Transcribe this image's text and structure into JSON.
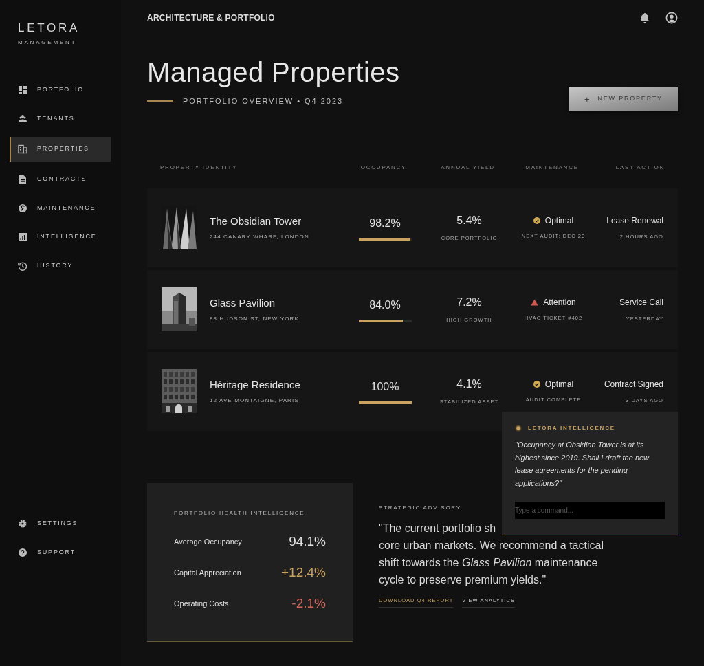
{
  "brand": {
    "name": "LETORA",
    "subtitle": "MANAGEMENT"
  },
  "nav": [
    {
      "label": "PORTFOLIO",
      "selected": false
    },
    {
      "label": "TENANTS",
      "selected": false
    },
    {
      "label": "PROPERTIES",
      "selected": true
    },
    {
      "label": "CONTRACTS",
      "selected": false
    },
    {
      "label": "MAINTENANCE",
      "selected": false
    },
    {
      "label": "INTELLIGENCE",
      "selected": false
    },
    {
      "label": "HISTORY",
      "selected": false
    }
  ],
  "footer_nav": [
    {
      "label": "SETTINGS"
    },
    {
      "label": "SUPPORT"
    }
  ],
  "header": {
    "breadcrumb": "ARCHITECTURE & PORTFOLIO"
  },
  "page": {
    "title": "Managed Properties",
    "subtitle": "PORTFOLIO OVERVIEW • Q4 2023"
  },
  "new_property_button": {
    "icon_text": "+",
    "label": "NEW PROPERTY"
  },
  "table": {
    "columns": [
      "PROPERTY IDENTITY",
      "OCCUPANCY",
      "ANNUAL YIELD",
      "MAINTENANCE",
      "LAST ACTION"
    ],
    "rows": [
      {
        "name": "The Obsidian Tower",
        "address": "244 CANARY WHARF, LONDON",
        "occupancy": "98.2%",
        "level": 0.982,
        "yield": "5.4%",
        "yield_note": "CORE PORTFOLIO",
        "maintenance": {
          "status": "Optimal",
          "kind": "ok",
          "note": "NEXT AUDIT: DEC 20"
        },
        "last_action": "Lease Renewal",
        "time": "2 HOURS AGO"
      },
      {
        "name": "Glass Pavilion",
        "address": "88 HUDSON ST, NEW YORK",
        "occupancy": "84.0%",
        "level": 0.84,
        "yield": "7.2%",
        "yield_note": "HIGH GROWTH",
        "maintenance": {
          "status": "Attention",
          "kind": "warning",
          "note": "HVAC TICKET #402"
        },
        "last_action": "Service Call",
        "time": "YESTERDAY"
      },
      {
        "name": "Héritage Residence",
        "address": "12 AVE MONTAIGNE, PARIS",
        "occupancy": "100%",
        "level": 1,
        "yield": "4.1%",
        "yield_note": "STABILIZED ASSET",
        "maintenance": {
          "status": "Optimal",
          "kind": "ok",
          "note": "AUDIT COMPLETE"
        },
        "last_action": "Contract Signed",
        "time": "3 DAYS AGO"
      }
    ]
  },
  "health": {
    "title": "PORTFOLIO HEALTH INTELLIGENCE",
    "metrics": [
      {
        "label": "Average Occupancy",
        "value": "94.1%",
        "kind": "neutral"
      },
      {
        "label": "Capital Appreciation",
        "value": "+12.4%",
        "kind": "positive"
      },
      {
        "label": "Operating Costs",
        "value": "-2.1%",
        "kind": "negative"
      }
    ]
  },
  "advisory": {
    "label": "STRATEGIC ADVISORY",
    "quote_start": "\"The current portfolio sh",
    "quote": "core urban markets. We recommend a tactical shift towards the *Glass Pavilion* maintenance cycle to preserve premium yields.\"",
    "links": [
      {
        "label": "DOWNLOAD Q4 REPORT",
        "kind": "primary"
      },
      {
        "label": "VIEW ANALYTICS",
        "kind": "secondary"
      }
    ]
  },
  "assistant": {
    "title": "LETORA INTELLIGENCE",
    "message": "\"Occupancy at Obsidian Tower is at its highest since 2019. Shall I draft the new lease agreements for the pending applications?\"",
    "placeholder": "Type a command..."
  }
}
